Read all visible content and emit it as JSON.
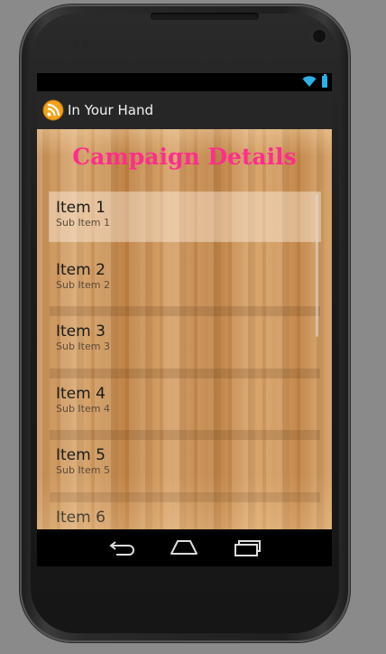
{
  "app": {
    "title": "In Your Hand",
    "icon": "rss-feed-icon"
  },
  "status_bar": {
    "icons": [
      "wifi-icon",
      "battery-icon"
    ],
    "accent_color": "#2bb1e4"
  },
  "page": {
    "title": "Campaign Details",
    "title_color": "#ff2d8c"
  },
  "list": {
    "items": [
      {
        "title": "Item 1",
        "subtitle": "Sub Item 1",
        "selected": true
      },
      {
        "title": "Item 2",
        "subtitle": "Sub Item 2"
      },
      {
        "title": "Item 3",
        "subtitle": "Sub Item 3"
      },
      {
        "title": "Item 4",
        "subtitle": "Sub Item 4"
      },
      {
        "title": "Item 5",
        "subtitle": "Sub Item 5"
      },
      {
        "title": "Item 6",
        "subtitle": ""
      }
    ]
  },
  "nav_bar": {
    "buttons": [
      "back-icon",
      "home-icon",
      "recent-apps-icon"
    ]
  }
}
